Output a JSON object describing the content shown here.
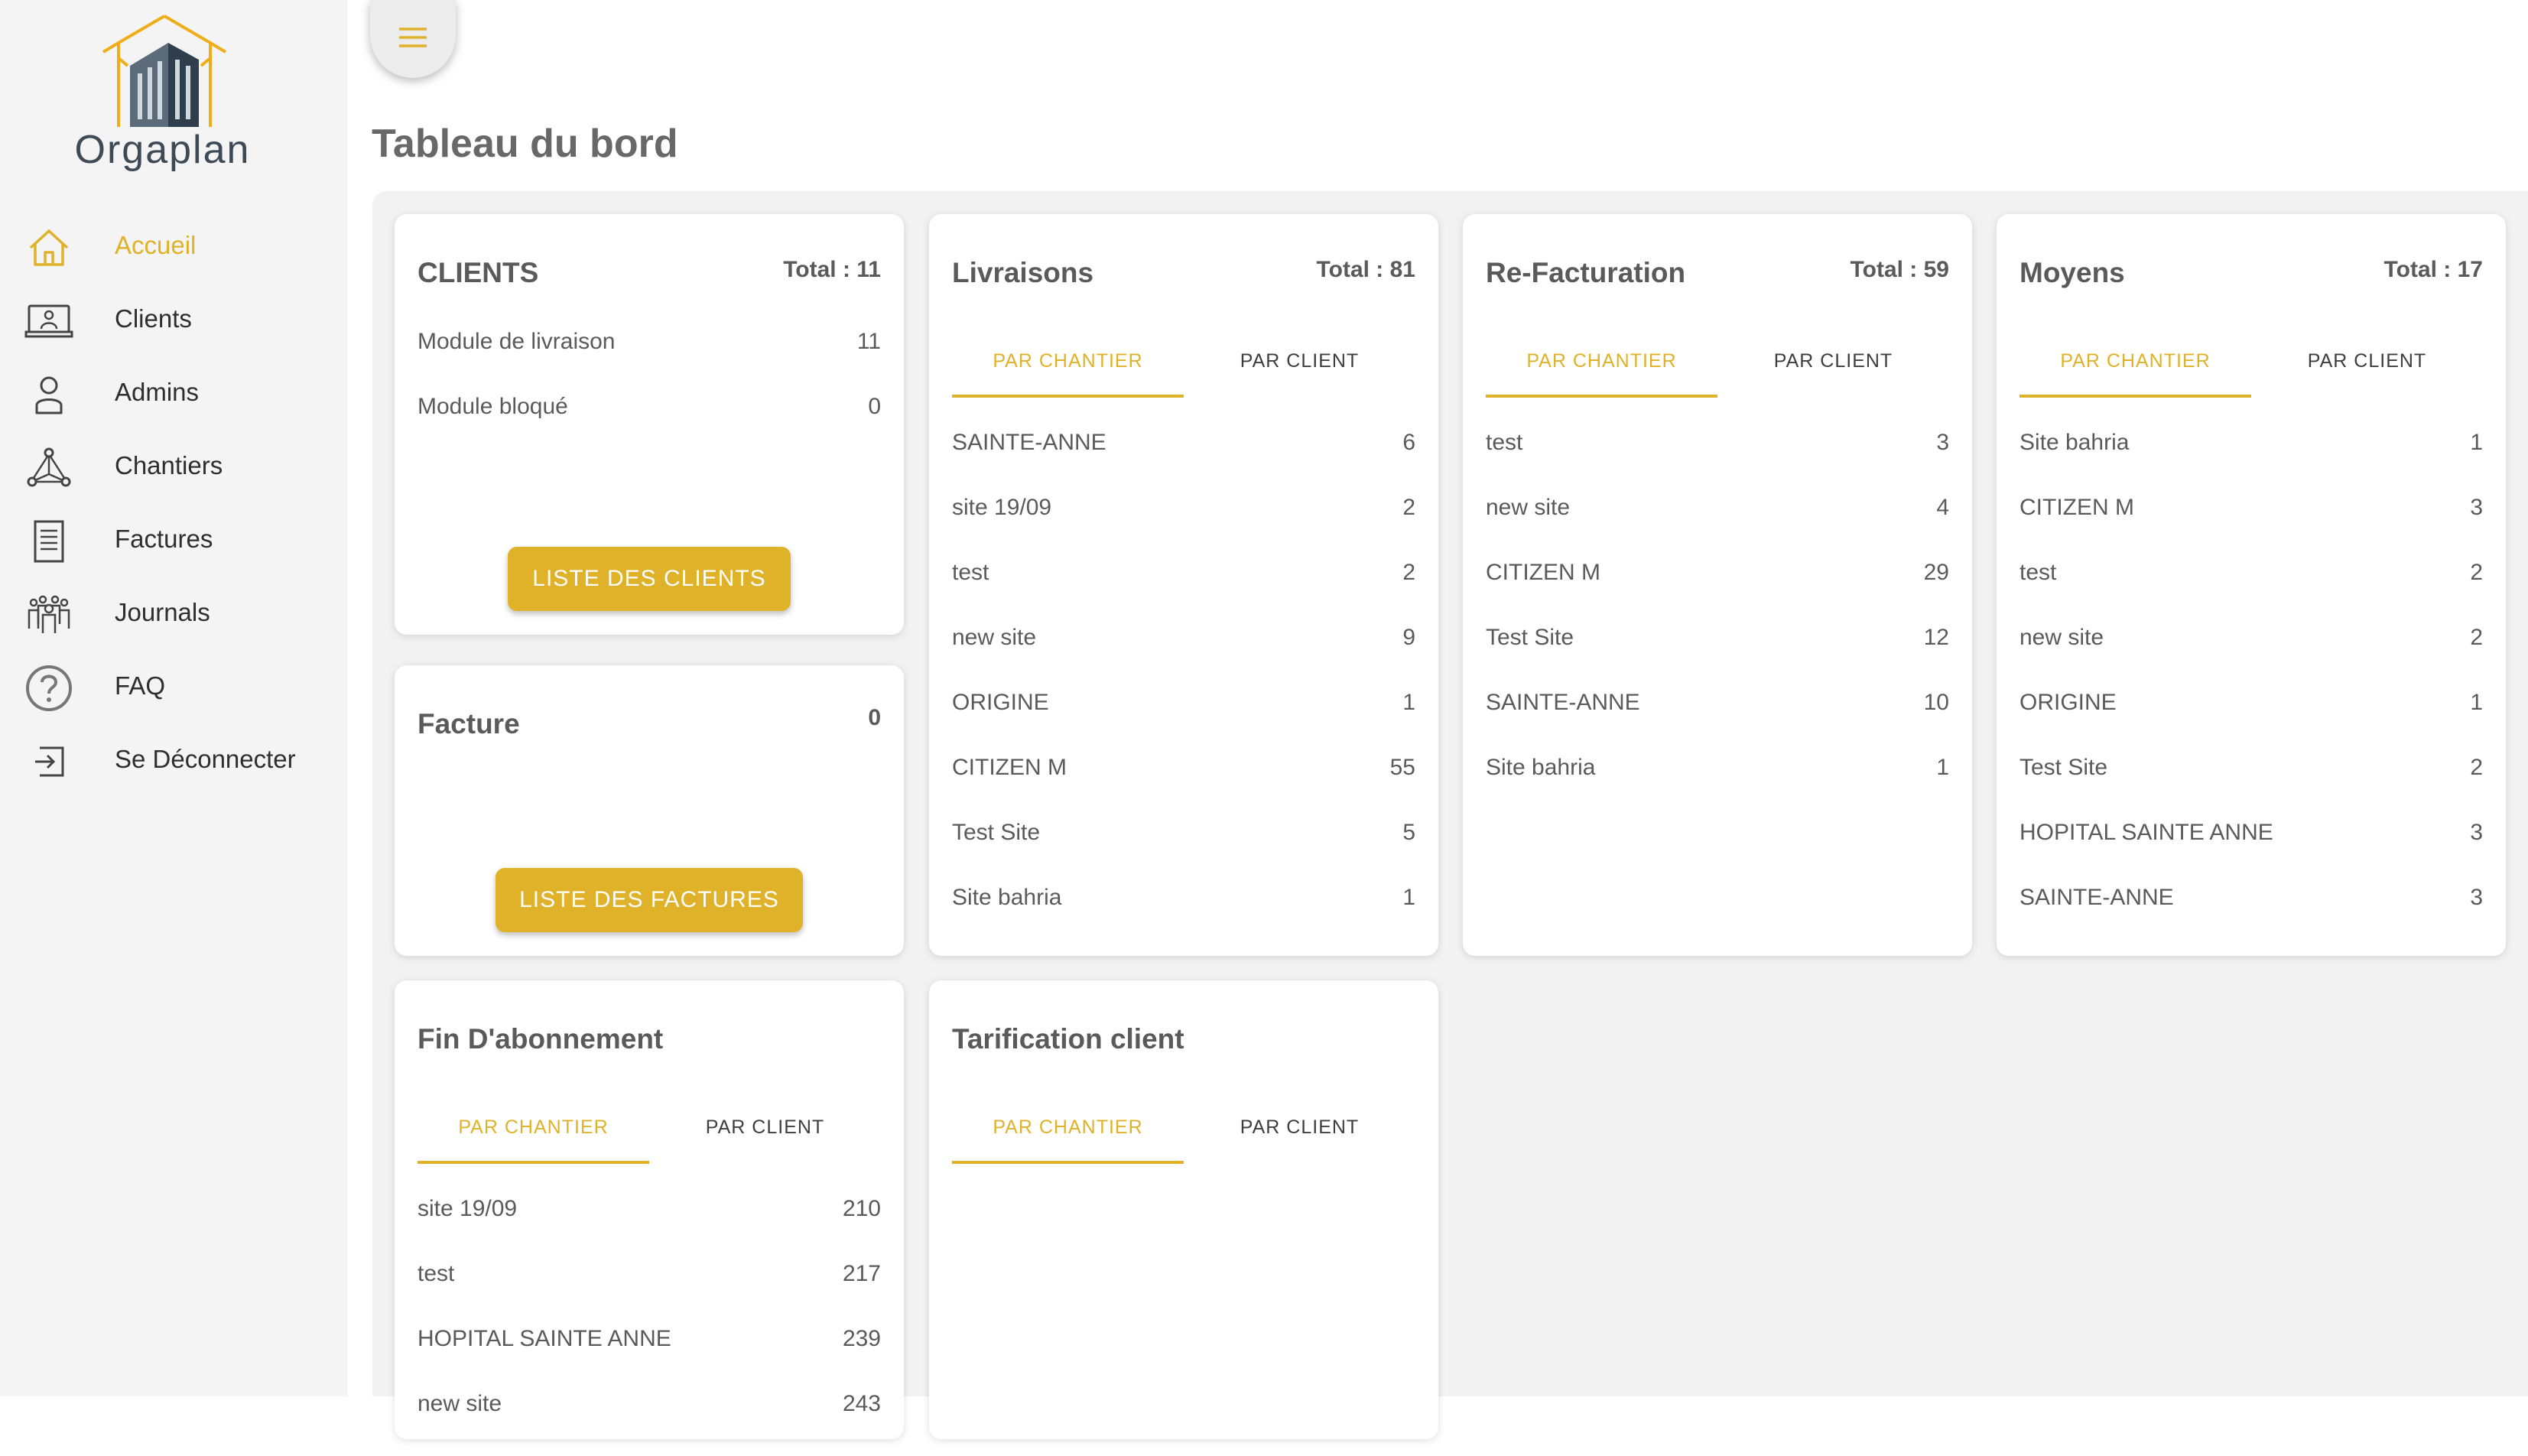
{
  "app": {
    "name": "Orgaplan"
  },
  "sidebar": {
    "items": [
      {
        "label": "Accueil",
        "icon": "home-icon",
        "active": true
      },
      {
        "label": "Clients",
        "icon": "monitor-user-icon"
      },
      {
        "label": "Admins",
        "icon": "user-icon"
      },
      {
        "label": "Chantiers",
        "icon": "network-icon"
      },
      {
        "label": "Factures",
        "icon": "document-icon"
      },
      {
        "label": "Journals",
        "icon": "group-icon"
      },
      {
        "label": "FAQ",
        "icon": "question-icon"
      },
      {
        "label": "Se Déconnecter",
        "icon": "logout-icon"
      }
    ]
  },
  "header": {
    "title": "Tableau du bord",
    "menu_icon": "hamburger-icon"
  },
  "colors": {
    "accent": "#e0b22a",
    "sidebar_bg": "#f4f4f4",
    "board_bg": "#f2f2f2"
  },
  "tabs": {
    "par_chantier": "PAR CHANTIER",
    "par_client": "PAR CLIENT"
  },
  "cards": {
    "clients": {
      "title": "CLIENTS",
      "total": "Total : 11",
      "rows": [
        {
          "label": "Module de livraison",
          "value": "11"
        },
        {
          "label": "Module bloqué",
          "value": "0"
        }
      ],
      "button": "LISTE DES CLIENTS"
    },
    "facture": {
      "title": "Facture",
      "total": "0",
      "button": "LISTE DES FACTURES"
    },
    "livraisons": {
      "title": "Livraisons",
      "total": "Total : 81",
      "rows": [
        {
          "label": "SAINTE-ANNE",
          "value": "6"
        },
        {
          "label": "site 19/09",
          "value": "2"
        },
        {
          "label": "test",
          "value": "2"
        },
        {
          "label": "new site",
          "value": "9"
        },
        {
          "label": "ORIGINE",
          "value": "1"
        },
        {
          "label": "CITIZEN M",
          "value": "55"
        },
        {
          "label": "Test Site",
          "value": "5"
        },
        {
          "label": "Site bahria",
          "value": "1"
        }
      ]
    },
    "refacturation": {
      "title": "Re-Facturation",
      "total": "Total : 59",
      "rows": [
        {
          "label": "test",
          "value": "3"
        },
        {
          "label": "new site",
          "value": "4"
        },
        {
          "label": "CITIZEN M",
          "value": "29"
        },
        {
          "label": "Test Site",
          "value": "12"
        },
        {
          "label": "SAINTE-ANNE",
          "value": "10"
        },
        {
          "label": "Site bahria",
          "value": "1"
        }
      ]
    },
    "moyens": {
      "title": "Moyens",
      "total": "Total : 17",
      "rows": [
        {
          "label": "Site bahria",
          "value": "1"
        },
        {
          "label": "CITIZEN M",
          "value": "3"
        },
        {
          "label": "test",
          "value": "2"
        },
        {
          "label": "new site",
          "value": "2"
        },
        {
          "label": "ORIGINE",
          "value": "1"
        },
        {
          "label": "Test Site",
          "value": "2"
        },
        {
          "label": "HOPITAL SAINTE ANNE",
          "value": "3"
        },
        {
          "label": "SAINTE-ANNE",
          "value": "3"
        }
      ]
    },
    "fin_abonnement": {
      "title": "Fin D'abonnement",
      "rows": [
        {
          "label": "site 19/09",
          "value": "210"
        },
        {
          "label": "test",
          "value": "217"
        },
        {
          "label": "HOPITAL SAINTE ANNE",
          "value": "239"
        },
        {
          "label": "new site",
          "value": "243"
        }
      ]
    },
    "tarification": {
      "title": "Tarification client"
    }
  }
}
